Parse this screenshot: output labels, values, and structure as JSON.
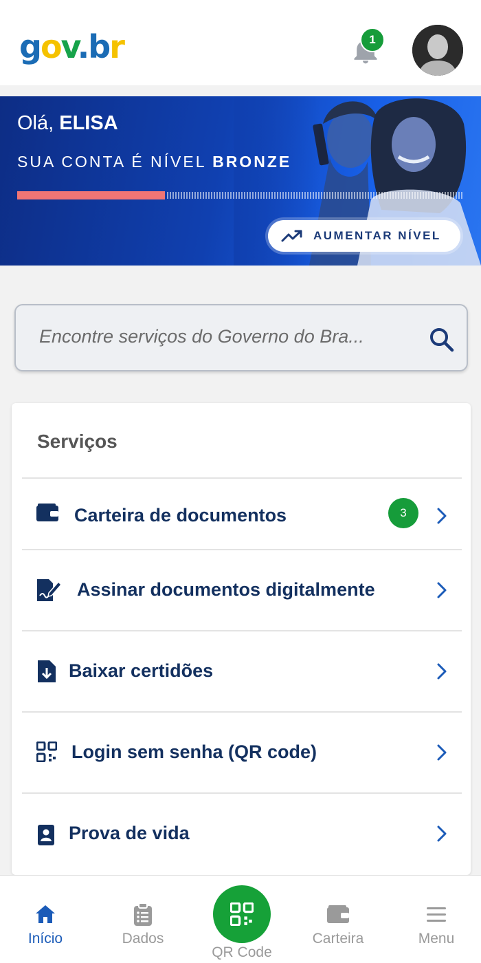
{
  "header": {
    "logo": {
      "g": "g",
      "o": "o",
      "v": "v",
      "dot": ".",
      "b": "b",
      "r": "r"
    },
    "notifications_count": "1"
  },
  "banner": {
    "greeting_prefix": "Olá, ",
    "user_name": "ELISA",
    "level_prefix": "SUA CONTA É NÍVEL ",
    "level_name": "BRONZE",
    "level_progress": 0.33,
    "upgrade_button": "AUMENTAR NÍVEL"
  },
  "search": {
    "placeholder": "Encontre serviços do Governo do Bra..."
  },
  "services": {
    "title": "Serviços",
    "items": [
      {
        "label": "Carteira de documentos",
        "icon": "wallet-icon",
        "badge": "3"
      },
      {
        "label": "Assinar documentos digitalmente",
        "icon": "sign-document-icon"
      },
      {
        "label": "Baixar certidões",
        "icon": "download-file-icon"
      },
      {
        "label": "Login sem senha (QR code)",
        "icon": "qr-code-icon"
      },
      {
        "label": "Prova de vida",
        "icon": "id-badge-icon"
      }
    ]
  },
  "bottom_nav": {
    "items": [
      {
        "label": "Início",
        "icon": "home-icon",
        "active": true
      },
      {
        "label": "Dados",
        "icon": "clipboard-icon"
      },
      {
        "label": "QR Code",
        "icon": "qr-code-icon"
      },
      {
        "label": "Carteira",
        "icon": "wallet-icon"
      },
      {
        "label": "Menu",
        "icon": "menu-icon"
      }
    ]
  },
  "colors": {
    "primary_blue": "#1b3a78",
    "green": "#169c3a",
    "progress_pink": "#f07575"
  }
}
